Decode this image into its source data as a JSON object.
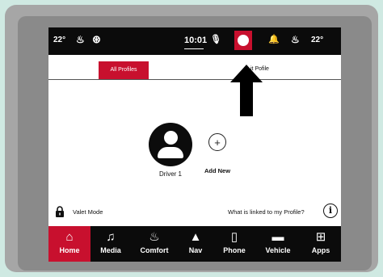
{
  "status_bar": {
    "temp_left": "22°",
    "time": "10:01",
    "temp_right": "22°",
    "record_color": "#c8102e"
  },
  "tabs": {
    "all_profiles": "All Profiles",
    "edit_profile": "it Pofile"
  },
  "profiles": [
    {
      "label": "Driver 1",
      "icon": "person-icon"
    }
  ],
  "add_new": {
    "label": "Add New",
    "icon": "plus-icon"
  },
  "valet": {
    "label": "Valet Mode",
    "icon": "lock-icon"
  },
  "linked": {
    "label": "What is linked to my Profile?",
    "icon": "info-icon"
  },
  "nav": [
    {
      "label": "Home",
      "icon": "home-icon",
      "active": true
    },
    {
      "label": "Media",
      "icon": "music-icon"
    },
    {
      "label": "Comfort",
      "icon": "comfort-icon"
    },
    {
      "label": "Nav",
      "icon": "nav-arrow-icon"
    },
    {
      "label": "Phone",
      "icon": "phone-icon"
    },
    {
      "label": "Vehicle",
      "icon": "car-icon"
    },
    {
      "label": "Apps",
      "icon": "apps-grid-icon"
    }
  ],
  "colors": {
    "accent": "#c8102e",
    "background": "#cfe9e2",
    "bar": "#0b0b0b"
  }
}
